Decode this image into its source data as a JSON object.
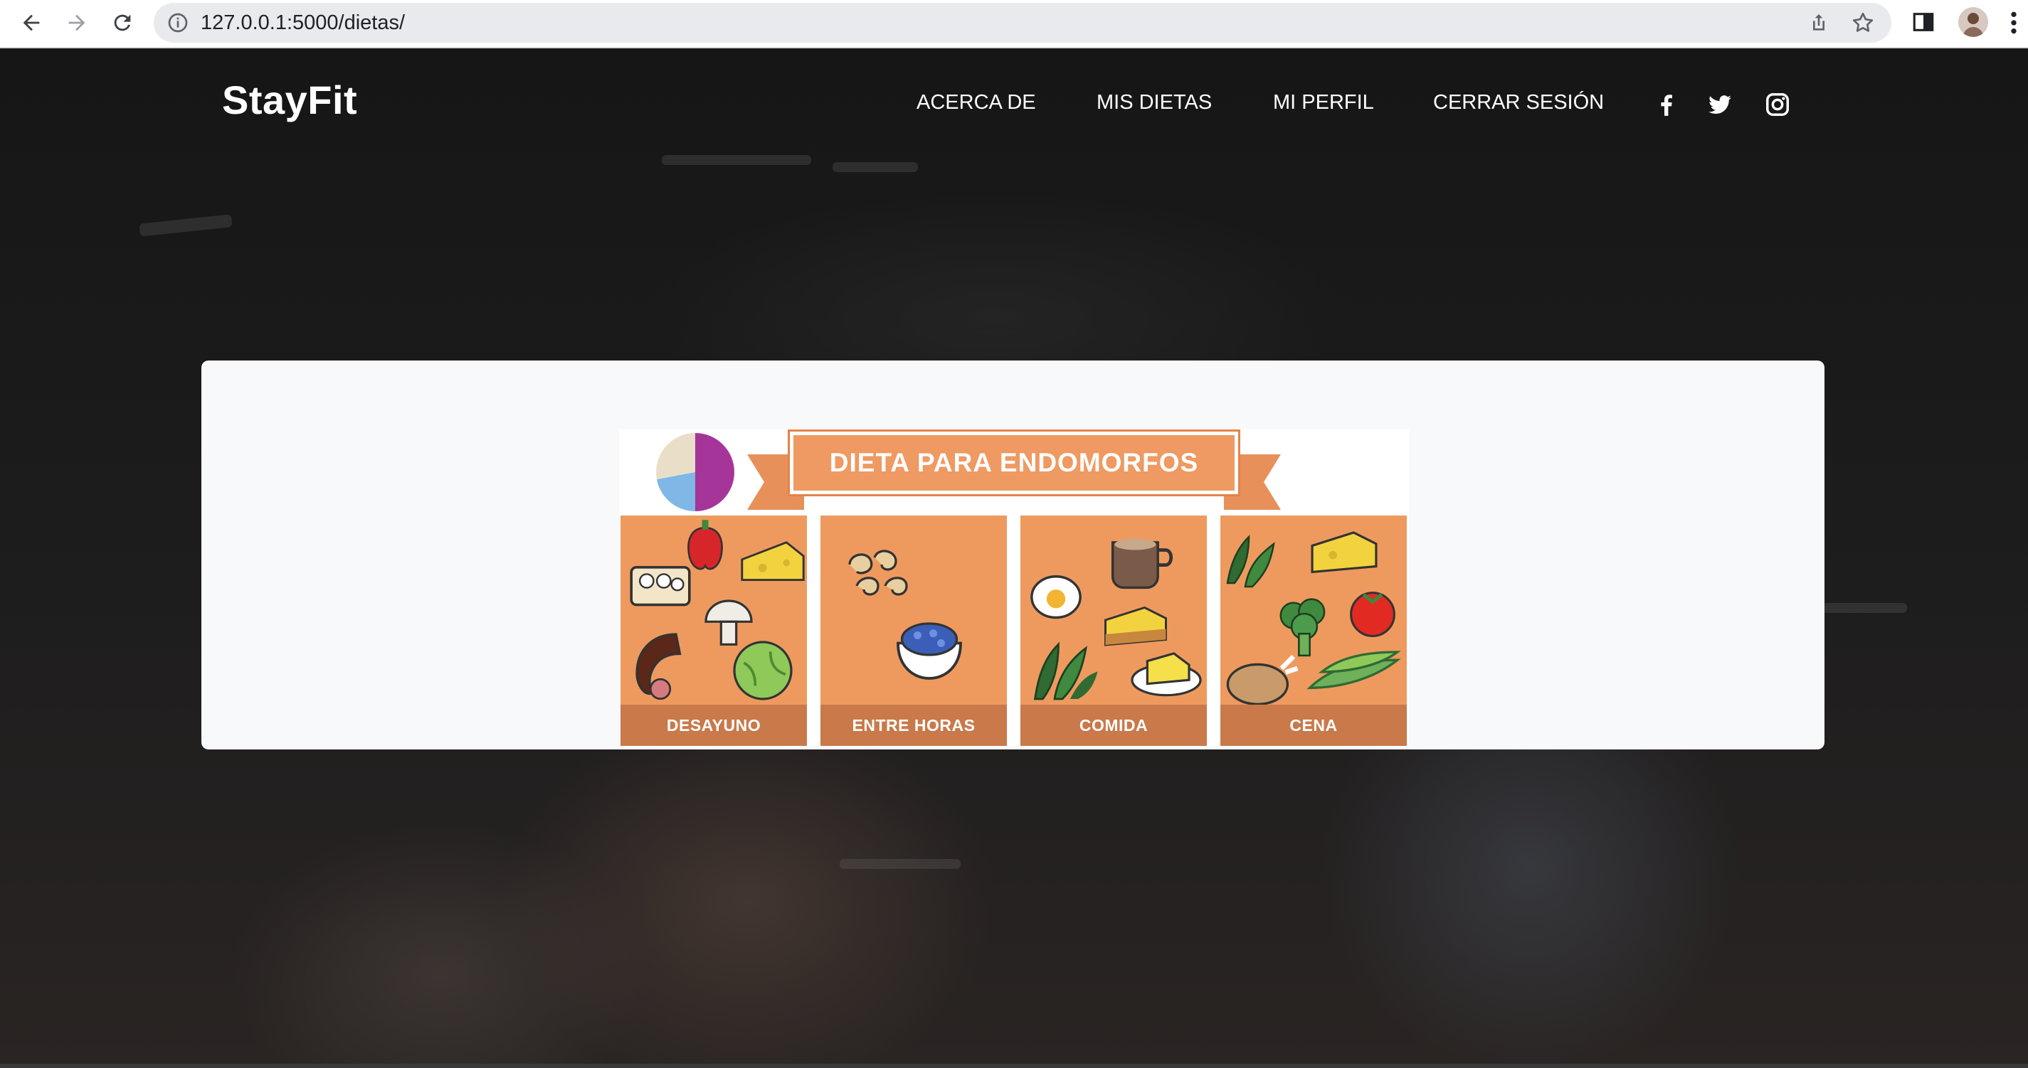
{
  "browser": {
    "url": "127.0.0.1:5000/dietas/"
  },
  "navbar": {
    "brand": "StayFit",
    "items": [
      {
        "label": "ACERCA DE"
      },
      {
        "label": "MIS DIETAS"
      },
      {
        "label": "MI PERFIL"
      },
      {
        "label": "CERRAR SESIÓN"
      }
    ],
    "social": [
      "facebook-icon",
      "twitter-icon",
      "instagram-icon"
    ]
  },
  "diet_poster": {
    "title": "DIETA PARA ENDOMORFOS",
    "meals": [
      {
        "label": "DESAYUNO"
      },
      {
        "label": "ENTRE HORAS"
      },
      {
        "label": "COMIDA"
      },
      {
        "label": "CENA"
      }
    ]
  },
  "colors": {
    "card_bg": "#f8f9fa",
    "poster_orange": "#ee9a5f",
    "poster_dark_orange": "#c9794a",
    "navbar_text": "#ffffff"
  }
}
